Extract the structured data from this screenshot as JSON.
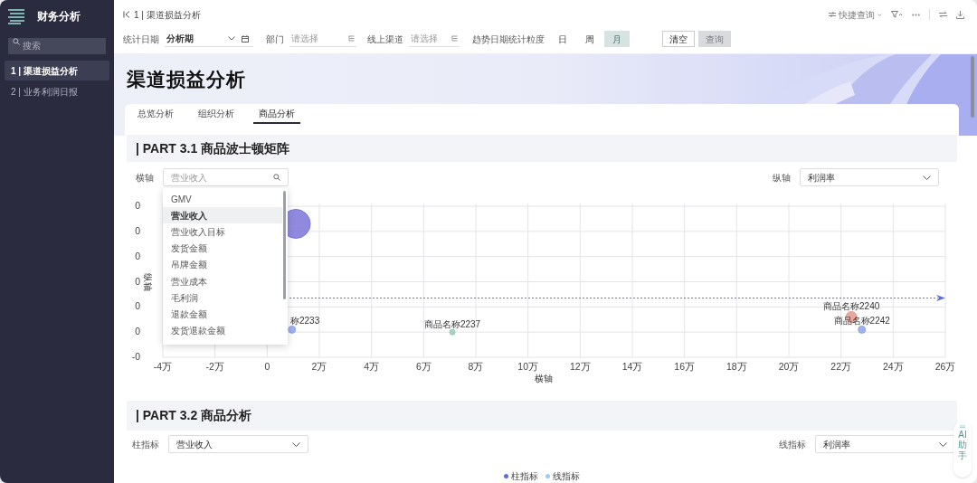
{
  "sidebar": {
    "title": "财务分析",
    "search": {
      "placeholder": "搜索"
    },
    "items": [
      {
        "label": "1 | 渠道损益分析",
        "selected": true
      },
      {
        "label": "2 | 业务利润日报",
        "selected": false
      }
    ]
  },
  "breadcrumb": "1 | 渠道损益分析",
  "toolbar": {
    "quick_query": "快捷查询"
  },
  "filters": {
    "date_label": "统计日期",
    "date_value": "分析期",
    "dept_label": "部门",
    "dept_placeholder": "请选择",
    "channel_label": "线上渠道",
    "channel_placeholder": "请选择",
    "granularity_label": "趋势日期统计粒度",
    "granularity": [
      {
        "label": "日",
        "selected": false
      },
      {
        "label": "周",
        "selected": false
      },
      {
        "label": "月",
        "selected": true
      }
    ],
    "buttons": [
      {
        "label": "清空",
        "disabled": false
      },
      {
        "label": "查询",
        "disabled": true
      }
    ]
  },
  "page_title": "渠道损益分析",
  "tabs": [
    {
      "label": "总览分析",
      "selected": false
    },
    {
      "label": "组织分析",
      "selected": false
    },
    {
      "label": "商品分析",
      "selected": true
    }
  ],
  "part1": {
    "title": "| PART 3.1 商品波士顿矩阵",
    "x_select": {
      "label": "横轴",
      "placeholder": "营业收入"
    },
    "dropdown": [
      {
        "label": "GMV",
        "selected": false
      },
      {
        "label": "营业收入",
        "selected": true
      },
      {
        "label": "营业收入目标",
        "selected": false
      },
      {
        "label": "发货金额",
        "selected": false
      },
      {
        "label": "吊牌金额",
        "selected": false
      },
      {
        "label": "营业成本",
        "selected": false
      },
      {
        "label": "毛利润",
        "selected": false
      },
      {
        "label": "退款金额",
        "selected": false
      },
      {
        "label": "发货退款金额",
        "selected": false
      }
    ],
    "y_select": {
      "label": "纵轴",
      "value": "利润率"
    },
    "chart_data": {
      "type": "scatter",
      "xlabel": "横轴",
      "ylabel": "纵轴",
      "xlim": [
        -4,
        26
      ],
      "ylim": [
        -0.1,
        0.5
      ],
      "xticks": [
        {
          "value": -4,
          "label": "-4万"
        },
        {
          "value": -2,
          "label": "-2万"
        },
        {
          "value": 0,
          "label": "0"
        },
        {
          "value": 2,
          "label": "2万"
        },
        {
          "value": 4,
          "label": "4万"
        },
        {
          "value": 6,
          "label": "6万"
        },
        {
          "value": 8,
          "label": "8万"
        },
        {
          "value": 10,
          "label": "10万"
        },
        {
          "value": 12,
          "label": "12万"
        },
        {
          "value": 14,
          "label": "14万"
        },
        {
          "value": 16,
          "label": "16万"
        },
        {
          "value": 18,
          "label": "18万"
        },
        {
          "value": 20,
          "label": "20万"
        },
        {
          "value": 22,
          "label": "22万"
        },
        {
          "value": 24,
          "label": "24万"
        },
        {
          "value": 26,
          "label": "26万"
        }
      ],
      "yticks": [
        {
          "value": 0.5,
          "label": "0"
        },
        {
          "value": 0.4,
          "label": "0"
        },
        {
          "value": 0.3,
          "label": "0"
        },
        {
          "value": 0.2,
          "label": "0"
        },
        {
          "value": 0.1,
          "label": "0"
        },
        {
          "value": 0,
          "label": "0"
        },
        {
          "value": -0.1,
          "label": "-0"
        }
      ],
      "series": [
        {
          "color": "#7d76d8",
          "x": [
            1.1
          ],
          "values": [
            0.43
          ]
        },
        {
          "name": "称2233",
          "color": "#8fa3f0",
          "x": [
            0.95
          ],
          "values": [
            0.01
          ]
        },
        {
          "name": "商品名称2237",
          "color": "#9cc9b8",
          "x": [
            7.1
          ],
          "values": [
            0
          ]
        },
        {
          "name": "商品名称2240",
          "color": "#e39a8c",
          "x": [
            22.4
          ],
          "values": [
            0.06
          ]
        },
        {
          "name": "商品名称2242",
          "color": "#8fa3e8",
          "x": [
            22.8
          ],
          "values": [
            0.01
          ]
        }
      ],
      "grid": true,
      "ref_lines": [
        {
          "axis": "y",
          "value": 0.135
        }
      ]
    }
  },
  "part2": {
    "title": "| PART 3.2 商品分析",
    "bar_select": {
      "label": "柱指标",
      "value": "营业收入"
    },
    "line_select": {
      "label": "线指标",
      "value": "利润率"
    },
    "legend": [
      {
        "label": "柱指标",
        "color": "#5b6ee1"
      },
      {
        "label": "线指标",
        "color": "#9ccaf2"
      }
    ]
  },
  "ai_assistant": {
    "lines": [
      "AI",
      "助手"
    ]
  }
}
